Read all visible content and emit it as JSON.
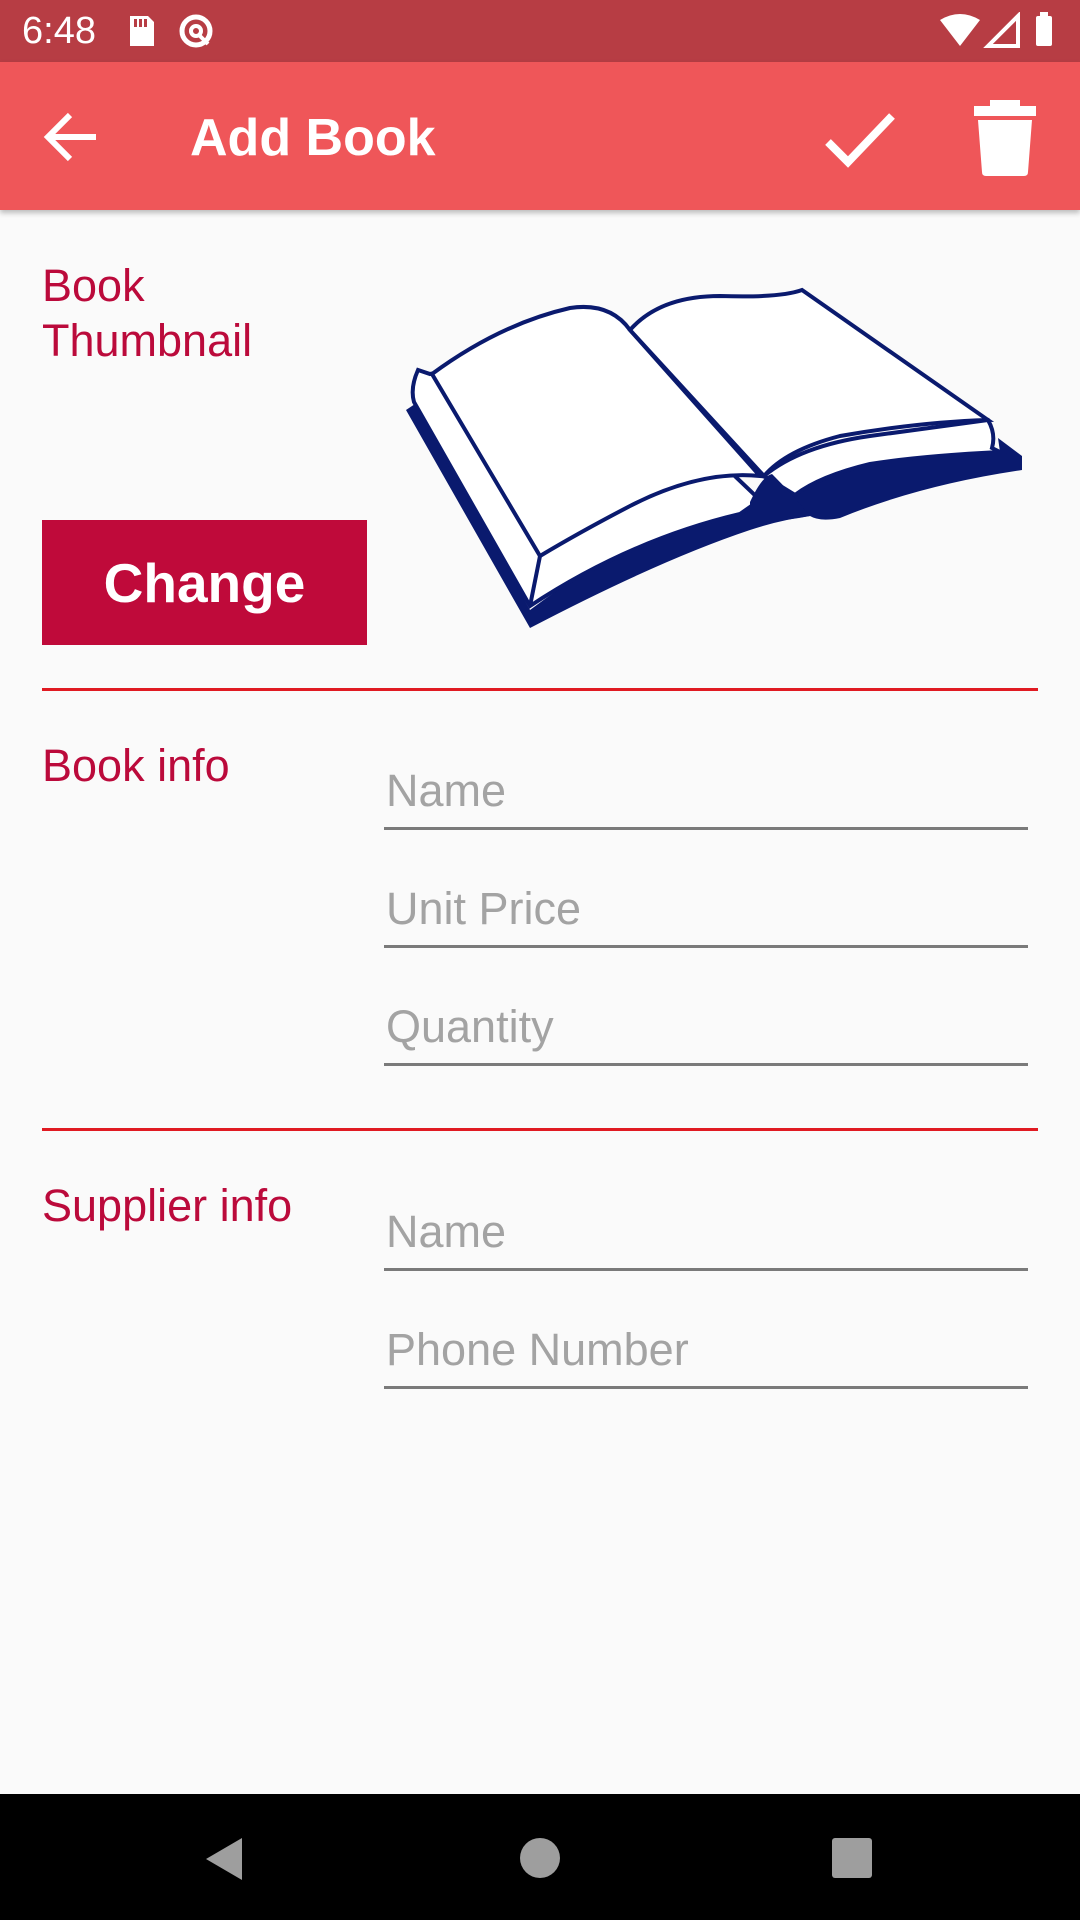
{
  "status_bar": {
    "time": "6:48",
    "left_icons": [
      "sd-card-icon",
      "data-saver-icon"
    ],
    "right_icons": [
      "wifi-icon",
      "cell-signal-icon",
      "battery-icon"
    ]
  },
  "app_bar": {
    "title": "Add Book",
    "back_icon": "arrow-back-icon",
    "save_icon": "check-icon",
    "delete_icon": "trash-icon",
    "color": "#ef5659"
  },
  "thumbnail_section": {
    "label": "Book\nThumbnail",
    "button_label": "Change",
    "image": "open-book-icon"
  },
  "book_info": {
    "label": "Book info",
    "fields": [
      {
        "placeholder": "Name",
        "value": ""
      },
      {
        "placeholder": "Unit Price",
        "value": ""
      },
      {
        "placeholder": "Quantity",
        "value": ""
      }
    ]
  },
  "supplier_info": {
    "label": "Supplier info",
    "fields": [
      {
        "placeholder": "Name",
        "value": ""
      },
      {
        "placeholder": "Phone Number",
        "value": ""
      }
    ]
  },
  "nav_bar": {
    "buttons": [
      "back-triangle-icon",
      "home-circle-icon",
      "recents-square-icon"
    ]
  },
  "colors": {
    "status_bar": "#b73d44",
    "accent": "#bb0a3b",
    "divider": "#e01a22",
    "background": "#fafafa"
  }
}
